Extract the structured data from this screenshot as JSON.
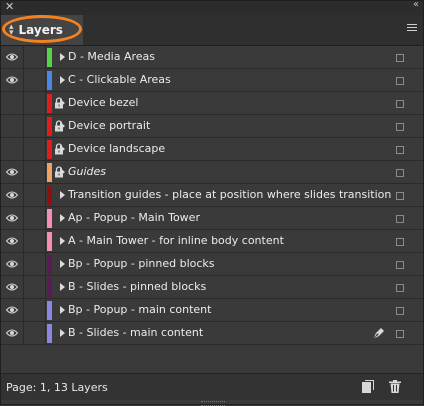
{
  "panel": {
    "tab_label": "Layers",
    "status": "Page: 1, 13 Layers"
  },
  "icons": {
    "close": "close-icon",
    "collapse": "double-chevron-icon",
    "menu": "panel-menu-icon",
    "visibility": "eye-icon",
    "lock": "lock-icon",
    "expand": "disclosure-triangle-icon",
    "pen": "pen-icon",
    "new_layer": "new-layer-icon",
    "delete": "trash-icon"
  },
  "layers": [
    {
      "name": "D - Media Areas",
      "color": "#56d24a",
      "visible": true,
      "locked": false,
      "italic": false,
      "pen": false
    },
    {
      "name": "C - Clickable Areas",
      "color": "#4a86e8",
      "visible": true,
      "locked": false,
      "italic": false,
      "pen": false
    },
    {
      "name": "Device bezel",
      "color": "#e21b1b",
      "visible": false,
      "locked": true,
      "italic": false,
      "pen": false
    },
    {
      "name": "Device portrait",
      "color": "#e21b1b",
      "visible": false,
      "locked": true,
      "italic": false,
      "pen": false
    },
    {
      "name": "Device landscape",
      "color": "#e21b1b",
      "visible": false,
      "locked": true,
      "italic": false,
      "pen": false
    },
    {
      "name": "Guides",
      "color": "#f0a260",
      "visible": true,
      "locked": true,
      "italic": true,
      "pen": false
    },
    {
      "name": "Transition guides - place at position where slides transition",
      "color": "#8c1212",
      "visible": true,
      "locked": false,
      "italic": false,
      "pen": false
    },
    {
      "name": "Ap - Popup - Main Tower",
      "color": "#f58fb8",
      "visible": true,
      "locked": false,
      "italic": false,
      "pen": false
    },
    {
      "name": "A - Main Tower - for inline body content",
      "color": "#f58fb8",
      "visible": true,
      "locked": false,
      "italic": false,
      "pen": false
    },
    {
      "name": "Bp - Popup - pinned blocks",
      "color": "#5a1a52",
      "visible": true,
      "locked": false,
      "italic": false,
      "pen": false
    },
    {
      "name": "B - Slides - pinned blocks",
      "color": "#5a1a52",
      "visible": true,
      "locked": false,
      "italic": false,
      "pen": false
    },
    {
      "name": "Bp - Popup - main content",
      "color": "#8b86e3",
      "visible": true,
      "locked": false,
      "italic": false,
      "pen": false
    },
    {
      "name": "B - Slides - main content",
      "color": "#8b86e3",
      "visible": true,
      "locked": false,
      "italic": false,
      "pen": true
    }
  ]
}
